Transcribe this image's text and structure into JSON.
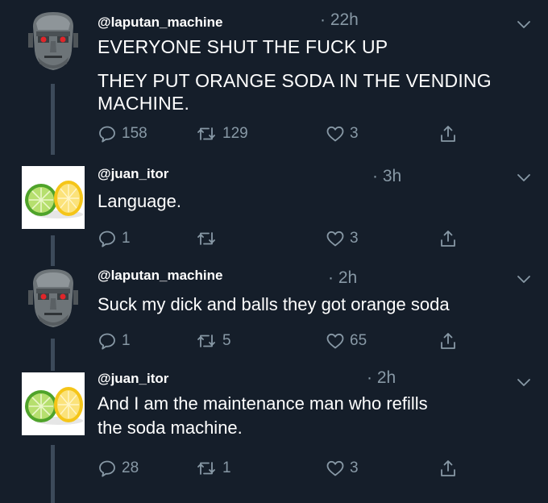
{
  "colors": {
    "background": "#151e2a",
    "text": "#ffffff",
    "muted": "#8899a6",
    "thread_line": "#3c4a5a"
  },
  "tweets": [
    {
      "handle": "@laputan_machine",
      "time": "· 22h",
      "avatar": "robot-face-avatar",
      "text": [
        "EVERYONE SHUT THE FUCK UP",
        "THEY PUT ORANGE SODA IN THE VENDING MACHINE."
      ],
      "replies": "158",
      "retweets": "129",
      "likes": "3"
    },
    {
      "handle": "@juan_itor",
      "time": "· 3h",
      "avatar": "lime-lemon-avatar",
      "text": [
        "Language."
      ],
      "replies": "1",
      "retweets": "",
      "likes": "3"
    },
    {
      "handle": "@laputan_machine",
      "time": "· 2h",
      "avatar": "robot-face-avatar",
      "text": [
        "Suck my dick and balls they got orange soda"
      ],
      "replies": "1",
      "retweets": "5",
      "likes": "65"
    },
    {
      "handle": "@juan_itor",
      "time": "· 2h",
      "avatar": "lime-lemon-avatar",
      "text": [
        "And I am the maintenance man who refills",
        "the soda machine."
      ],
      "replies": "28",
      "retweets": "1",
      "likes": "3"
    }
  ]
}
